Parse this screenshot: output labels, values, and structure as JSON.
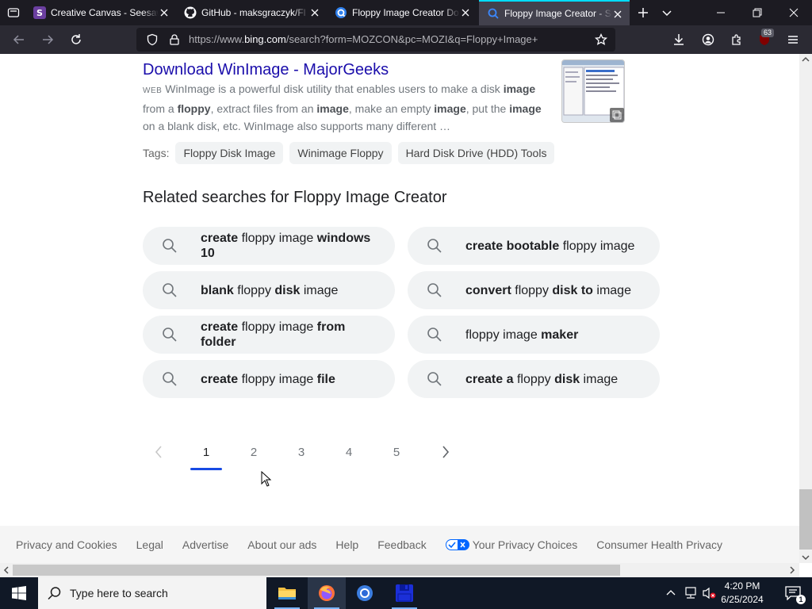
{
  "browser": {
    "tabs": [
      {
        "title": "Creative Canvas - Seesaw",
        "icon": "seesaw-icon"
      },
      {
        "title": "GitHub - maksgraczyk/Fl",
        "icon": "github-icon"
      },
      {
        "title": "Floppy Image Creator Do",
        "icon": "site-icon"
      },
      {
        "title": "Floppy Image Creator - Se",
        "icon": "bing-search-icon"
      }
    ],
    "url_prefix": "https://www.",
    "url_host": "bing.com",
    "url_path": "/search?form=MOZCON&pc=MOZI&q=Floppy+Image+Creator",
    "extension_badge": "63"
  },
  "result": {
    "title": "Download WinImage - MajorGeeks",
    "web_label": "WEB",
    "snippet_parts": [
      {
        "t": "WinImage is a powerful disk utility that enables users to make a disk ",
        "b": false
      },
      {
        "t": "image",
        "b": true
      },
      {
        "t": " from a ",
        "b": false
      },
      {
        "t": "floppy",
        "b": true
      },
      {
        "t": ", extract files from an ",
        "b": false
      },
      {
        "t": "image",
        "b": true
      },
      {
        "t": ", make an empty ",
        "b": false
      },
      {
        "t": "image",
        "b": true
      },
      {
        "t": ", put the ",
        "b": false
      },
      {
        "t": "image",
        "b": true
      },
      {
        "t": " on a blank disk, etc. WinImage also supports many different …",
        "b": false
      }
    ],
    "tags_label": "Tags:",
    "tags": [
      "Floppy Disk Image",
      "Winimage Floppy",
      "Hard Disk Drive (HDD) Tools"
    ]
  },
  "related": {
    "heading": "Related searches for Floppy Image Creator",
    "items": [
      [
        {
          "t": "create",
          "b": true
        },
        {
          "t": " floppy image ",
          "b": false
        },
        {
          "t": "windows 10",
          "b": true
        }
      ],
      [
        {
          "t": "create bootable",
          "b": true
        },
        {
          "t": " floppy image",
          "b": false
        }
      ],
      [
        {
          "t": "blank",
          "b": true
        },
        {
          "t": " floppy ",
          "b": false
        },
        {
          "t": "disk",
          "b": true
        },
        {
          "t": " image",
          "b": false
        }
      ],
      [
        {
          "t": "convert",
          "b": true
        },
        {
          "t": " floppy ",
          "b": false
        },
        {
          "t": "disk to",
          "b": true
        },
        {
          "t": " image",
          "b": false
        }
      ],
      [
        {
          "t": "create",
          "b": true
        },
        {
          "t": " floppy image ",
          "b": false
        },
        {
          "t": "from folder",
          "b": true
        }
      ],
      [
        {
          "t": "floppy image ",
          "b": false
        },
        {
          "t": "maker",
          "b": true
        }
      ],
      [
        {
          "t": "create",
          "b": true
        },
        {
          "t": " floppy image ",
          "b": false
        },
        {
          "t": "file",
          "b": true
        }
      ],
      [
        {
          "t": "create a",
          "b": true
        },
        {
          "t": " floppy ",
          "b": false
        },
        {
          "t": "disk",
          "b": true
        },
        {
          "t": " image",
          "b": false
        }
      ]
    ]
  },
  "pagination": {
    "pages": [
      "1",
      "2",
      "3",
      "4",
      "5"
    ],
    "current": "1"
  },
  "footer": {
    "links": [
      "Privacy and Cookies",
      "Legal",
      "Advertise",
      "About our ads",
      "Help",
      "Feedback",
      "Your Privacy Choices",
      "Consumer Health Privacy"
    ]
  },
  "taskbar": {
    "search_placeholder": "Type here to search",
    "time": "4:20 PM",
    "date": "6/25/2024",
    "notification_count": "1"
  },
  "colors": {
    "link": "#1a0dab",
    "accent_tab": "#00ddff",
    "pager_underline": "#174ae4"
  }
}
